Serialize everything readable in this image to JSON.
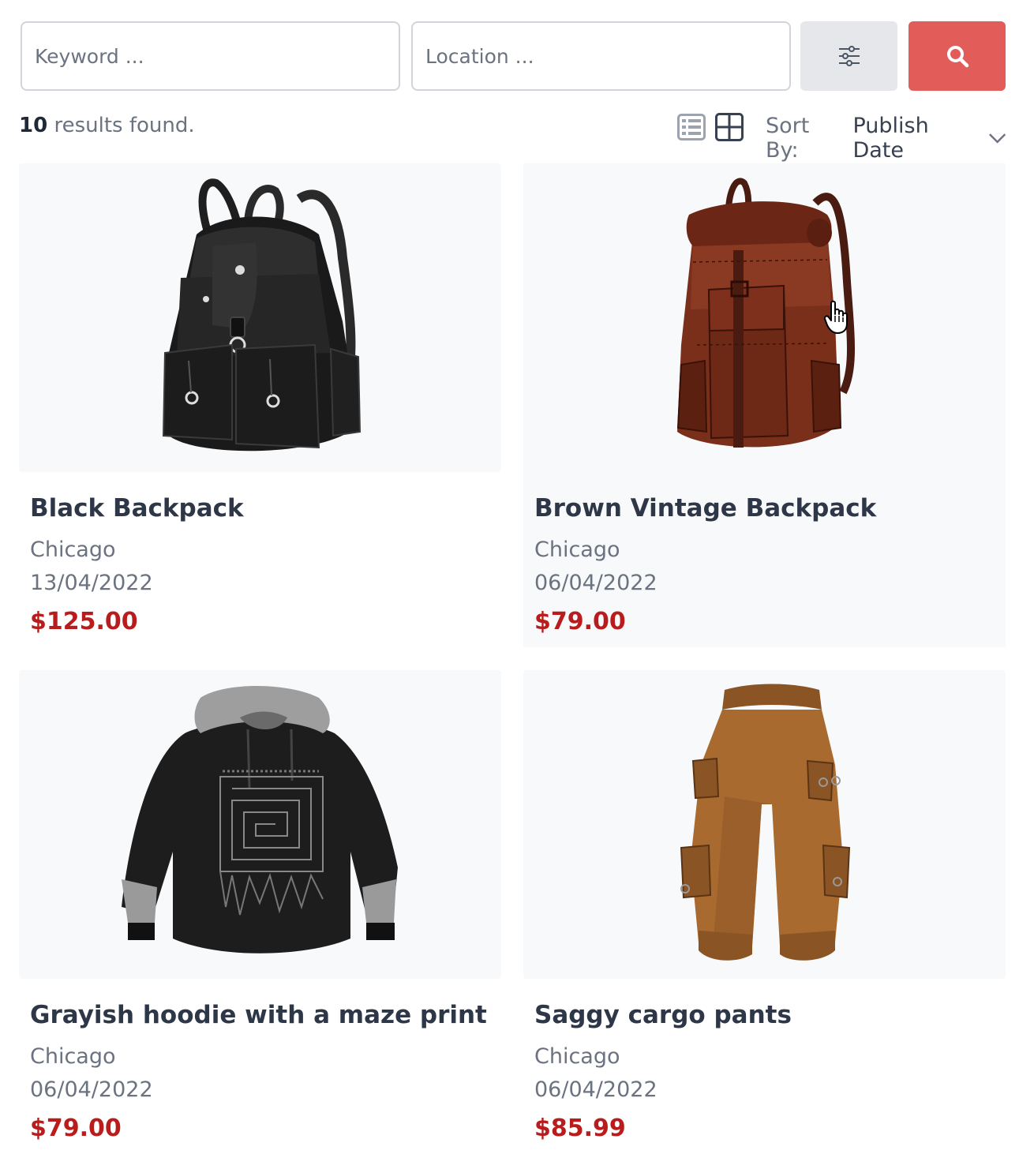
{
  "search": {
    "keyword_placeholder": "Keyword ...",
    "location_placeholder": "Location ...",
    "filter_icon": "sliders-icon",
    "search_icon": "search-icon",
    "search_button_color": "#e25c5a"
  },
  "results": {
    "count": "10",
    "count_suffix": " results found.",
    "sort_label": "Sort By:",
    "sort_value": "Publish Date",
    "view_list_icon": "list-view-icon",
    "view_grid_icon": "grid-view-icon"
  },
  "products": [
    {
      "title": "Black Backpack",
      "location": "Chicago",
      "date": "13/04/2022",
      "price": "$125.00",
      "image": "black-backpack"
    },
    {
      "title": "Brown Vintage Backpack",
      "location": "Chicago",
      "date": "06/04/2022",
      "price": "$79.00",
      "image": "brown-backpack"
    },
    {
      "title": "Grayish hoodie with a maze print",
      "location": "Chicago",
      "date": "06/04/2022",
      "price": "$79.00",
      "image": "hoodie"
    },
    {
      "title": "Saggy cargo pants",
      "location": "Chicago",
      "date": "06/04/2022",
      "price": "$85.99",
      "image": "cargo-pants"
    }
  ],
  "colors": {
    "price": "#b91c1c",
    "title": "#2d3748",
    "muted": "#6b7280",
    "card_bg": "#f8f9fb"
  }
}
